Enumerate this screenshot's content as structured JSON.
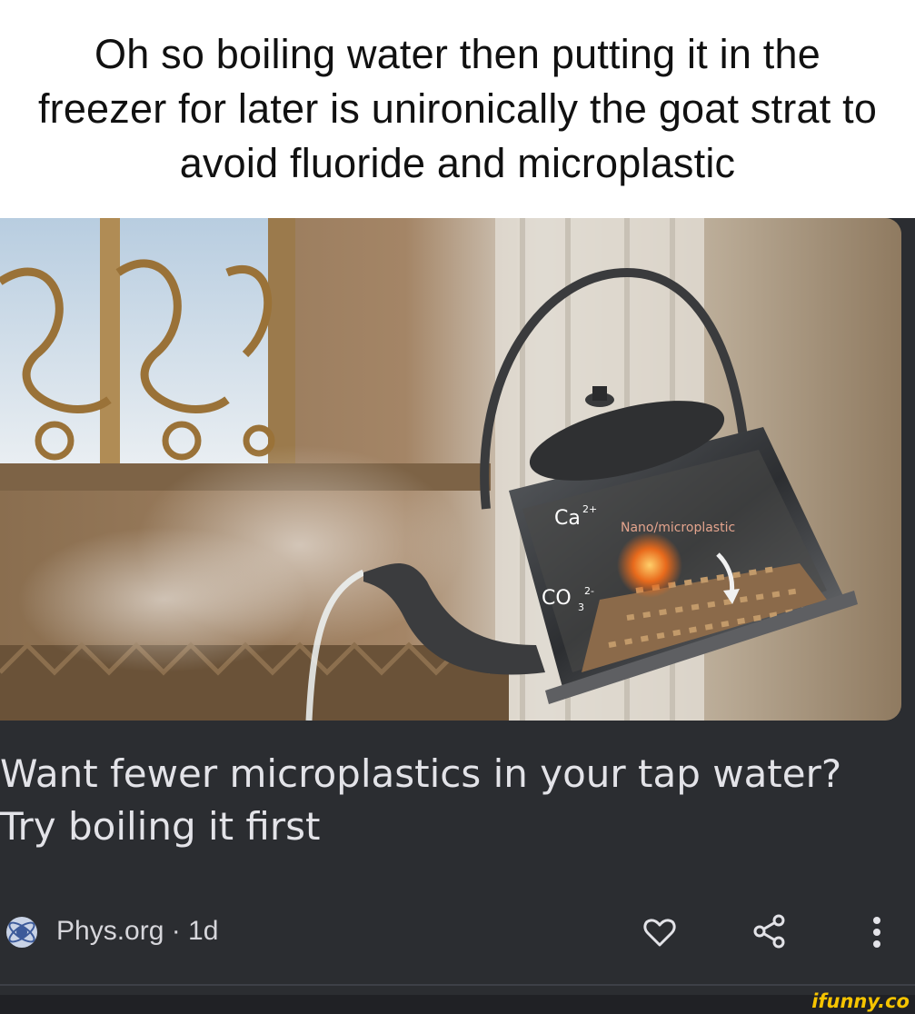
{
  "caption": {
    "text": "Oh so boiling water then putting it in the freezer for later is unironically the goat strat to avoid fluoride and microplastic"
  },
  "article": {
    "image_labels": {
      "ca": "Ca",
      "ca_charge": "2+",
      "co": "CO",
      "co_sub": "3",
      "co_charge": "2-",
      "nano": "Nano/microplastic"
    },
    "headline": "Want fewer microplastics in your tap water? Try boiling it first",
    "source": "Phys.org · 1d",
    "actions": {
      "like_icon": "heart-icon",
      "share_icon": "share-icon",
      "more_icon": "more-vertical-icon"
    }
  },
  "watermark": "ifunny.co",
  "colors": {
    "card_background": "#2b2d31",
    "headline_text": "#e3e3e8",
    "watermark": "#f6c400"
  }
}
